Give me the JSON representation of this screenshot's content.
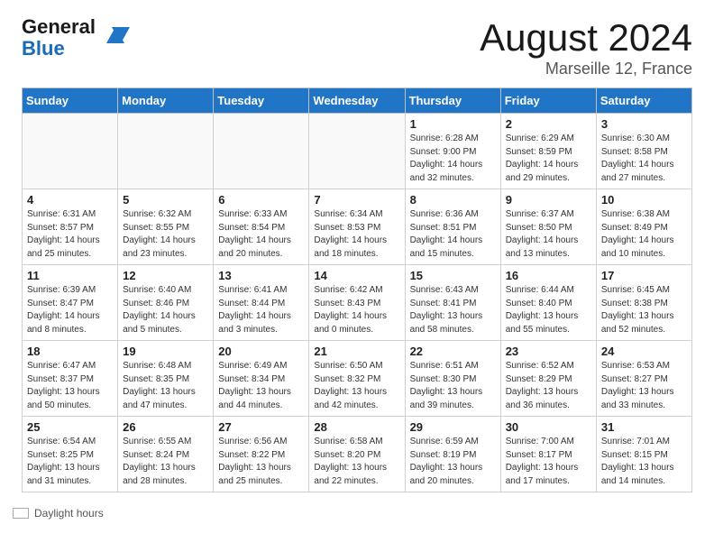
{
  "header": {
    "logo_general": "General",
    "logo_blue": "Blue",
    "month": "August 2024",
    "location": "Marseille 12, France"
  },
  "days_of_week": [
    "Sunday",
    "Monday",
    "Tuesday",
    "Wednesday",
    "Thursday",
    "Friday",
    "Saturday"
  ],
  "weeks": [
    [
      {
        "day": "",
        "info": ""
      },
      {
        "day": "",
        "info": ""
      },
      {
        "day": "",
        "info": ""
      },
      {
        "day": "",
        "info": ""
      },
      {
        "day": "1",
        "info": "Sunrise: 6:28 AM\nSunset: 9:00 PM\nDaylight: 14 hours\nand 32 minutes."
      },
      {
        "day": "2",
        "info": "Sunrise: 6:29 AM\nSunset: 8:59 PM\nDaylight: 14 hours\nand 29 minutes."
      },
      {
        "day": "3",
        "info": "Sunrise: 6:30 AM\nSunset: 8:58 PM\nDaylight: 14 hours\nand 27 minutes."
      }
    ],
    [
      {
        "day": "4",
        "info": "Sunrise: 6:31 AM\nSunset: 8:57 PM\nDaylight: 14 hours\nand 25 minutes."
      },
      {
        "day": "5",
        "info": "Sunrise: 6:32 AM\nSunset: 8:55 PM\nDaylight: 14 hours\nand 23 minutes."
      },
      {
        "day": "6",
        "info": "Sunrise: 6:33 AM\nSunset: 8:54 PM\nDaylight: 14 hours\nand 20 minutes."
      },
      {
        "day": "7",
        "info": "Sunrise: 6:34 AM\nSunset: 8:53 PM\nDaylight: 14 hours\nand 18 minutes."
      },
      {
        "day": "8",
        "info": "Sunrise: 6:36 AM\nSunset: 8:51 PM\nDaylight: 14 hours\nand 15 minutes."
      },
      {
        "day": "9",
        "info": "Sunrise: 6:37 AM\nSunset: 8:50 PM\nDaylight: 14 hours\nand 13 minutes."
      },
      {
        "day": "10",
        "info": "Sunrise: 6:38 AM\nSunset: 8:49 PM\nDaylight: 14 hours\nand 10 minutes."
      }
    ],
    [
      {
        "day": "11",
        "info": "Sunrise: 6:39 AM\nSunset: 8:47 PM\nDaylight: 14 hours\nand 8 minutes."
      },
      {
        "day": "12",
        "info": "Sunrise: 6:40 AM\nSunset: 8:46 PM\nDaylight: 14 hours\nand 5 minutes."
      },
      {
        "day": "13",
        "info": "Sunrise: 6:41 AM\nSunset: 8:44 PM\nDaylight: 14 hours\nand 3 minutes."
      },
      {
        "day": "14",
        "info": "Sunrise: 6:42 AM\nSunset: 8:43 PM\nDaylight: 14 hours\nand 0 minutes."
      },
      {
        "day": "15",
        "info": "Sunrise: 6:43 AM\nSunset: 8:41 PM\nDaylight: 13 hours\nand 58 minutes."
      },
      {
        "day": "16",
        "info": "Sunrise: 6:44 AM\nSunset: 8:40 PM\nDaylight: 13 hours\nand 55 minutes."
      },
      {
        "day": "17",
        "info": "Sunrise: 6:45 AM\nSunset: 8:38 PM\nDaylight: 13 hours\nand 52 minutes."
      }
    ],
    [
      {
        "day": "18",
        "info": "Sunrise: 6:47 AM\nSunset: 8:37 PM\nDaylight: 13 hours\nand 50 minutes."
      },
      {
        "day": "19",
        "info": "Sunrise: 6:48 AM\nSunset: 8:35 PM\nDaylight: 13 hours\nand 47 minutes."
      },
      {
        "day": "20",
        "info": "Sunrise: 6:49 AM\nSunset: 8:34 PM\nDaylight: 13 hours\nand 44 minutes."
      },
      {
        "day": "21",
        "info": "Sunrise: 6:50 AM\nSunset: 8:32 PM\nDaylight: 13 hours\nand 42 minutes."
      },
      {
        "day": "22",
        "info": "Sunrise: 6:51 AM\nSunset: 8:30 PM\nDaylight: 13 hours\nand 39 minutes."
      },
      {
        "day": "23",
        "info": "Sunrise: 6:52 AM\nSunset: 8:29 PM\nDaylight: 13 hours\nand 36 minutes."
      },
      {
        "day": "24",
        "info": "Sunrise: 6:53 AM\nSunset: 8:27 PM\nDaylight: 13 hours\nand 33 minutes."
      }
    ],
    [
      {
        "day": "25",
        "info": "Sunrise: 6:54 AM\nSunset: 8:25 PM\nDaylight: 13 hours\nand 31 minutes."
      },
      {
        "day": "26",
        "info": "Sunrise: 6:55 AM\nSunset: 8:24 PM\nDaylight: 13 hours\nand 28 minutes."
      },
      {
        "day": "27",
        "info": "Sunrise: 6:56 AM\nSunset: 8:22 PM\nDaylight: 13 hours\nand 25 minutes."
      },
      {
        "day": "28",
        "info": "Sunrise: 6:58 AM\nSunset: 8:20 PM\nDaylight: 13 hours\nand 22 minutes."
      },
      {
        "day": "29",
        "info": "Sunrise: 6:59 AM\nSunset: 8:19 PM\nDaylight: 13 hours\nand 20 minutes."
      },
      {
        "day": "30",
        "info": "Sunrise: 7:00 AM\nSunset: 8:17 PM\nDaylight: 13 hours\nand 17 minutes."
      },
      {
        "day": "31",
        "info": "Sunrise: 7:01 AM\nSunset: 8:15 PM\nDaylight: 13 hours\nand 14 minutes."
      }
    ]
  ],
  "footer": {
    "label": "Daylight hours"
  }
}
